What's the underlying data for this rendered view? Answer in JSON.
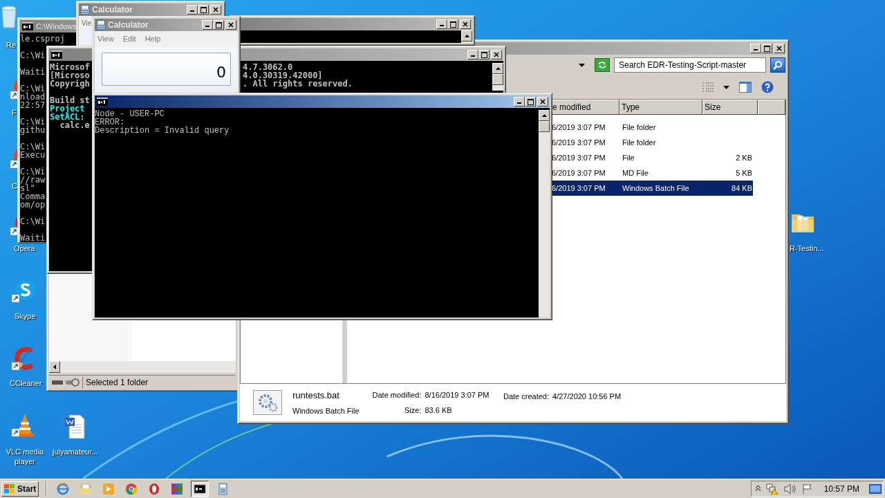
{
  "desktop_icons": [
    {
      "kind": "recycle",
      "label": "Re"
    },
    {
      "kind": "firefox",
      "label": "F"
    },
    {
      "kind": "chrome",
      "label": "C"
    },
    {
      "kind": "opera",
      "label": "Opera"
    },
    {
      "kind": "skype",
      "label": "Skype"
    },
    {
      "kind": "ccleaner",
      "label": "CCleaner"
    },
    {
      "kind": "vlc",
      "label": "VLC media player"
    },
    {
      "kind": "word",
      "label": "julyamateur..."
    },
    {
      "kind": "folder",
      "label": "R-Testin..."
    }
  ],
  "explorer_back": {
    "status": "Selected 1 folder"
  },
  "explorer": {
    "active": false,
    "search_placeholder": "Search EDR-Testing-Script-master",
    "columns": [
      "e modified",
      "Type",
      "Size"
    ],
    "rows": [
      {
        "modified": "6/2019 3:07 PM",
        "type": "File folder",
        "selected": false
      },
      {
        "modified": "6/2019 3:07 PM",
        "type": "File folder",
        "selected": false
      },
      {
        "modified": "6/2019 3:07 PM",
        "type": "File",
        "size": "2 KB",
        "selected": false
      },
      {
        "modified": "6/2019 3:07 PM",
        "type": "MD File",
        "size": "5 KB",
        "selected": false
      },
      {
        "modified": "6/2019 3:07 PM",
        "type": "Windows Batch File",
        "size": "84 KB",
        "selected": true
      }
    ],
    "details": {
      "name": "runtests.bat",
      "type": "Windows Batch File",
      "modified_label": "Date modified:",
      "modified": "8/16/2019 3:07 PM",
      "size_label": "Size:",
      "size": "83.6 KB",
      "created_label": "Date created:",
      "created": "4/27/2020 10:56 PM"
    }
  },
  "cmd_left": {
    "active": false,
    "title": "C:\\Windows",
    "blocks": [
      [
        "le.csproj"
      ],
      [
        "C:\\Wi"
      ],
      [
        "Waiti"
      ],
      [
        "C:\\Wi",
        "nload",
        "22:57"
      ],
      [
        "C:\\Wi",
        "githu"
      ],
      [
        "C:\\Wi",
        "Execu"
      ],
      [
        "C:\\Wi",
        "//raw",
        "sl\"",
        "Comma",
        "om/op"
      ],
      [
        "C:\\Wi"
      ],
      [
        "Waiti"
      ]
    ]
  },
  "calculator_back": {
    "active": false,
    "title": "Calculator",
    "menu": [
      "Vie"
    ]
  },
  "cmd_top": {
    "active": false
  },
  "cmd_middle": {
    "active": false,
    "left_blocks": [
      [
        {
          "text": "Microsof",
          "color": "#c0c0c0"
        },
        {
          "text": "[Microso",
          "color": "#c0c0c0"
        },
        {
          "text": "Copyrigh",
          "color": "#c0c0c0"
        }
      ],
      [
        {
          "text": "Build st",
          "color": "#c0c0c0"
        },
        {
          "text": "Project",
          "color": "#00ffff"
        },
        {
          "text": "SetACL:",
          "color": "#00ffff"
        },
        {
          "text": "  calc.e",
          "color": "#c0c0c0"
        }
      ]
    ],
    "right_lines": [
      "4.7.3062.0",
      "4.0.30319.42000]",
      ". All rights reserved."
    ]
  },
  "calculator_front": {
    "active": false,
    "title": "Calculator",
    "menu": [
      "View",
      "Edit",
      "Help"
    ],
    "display": "0"
  },
  "cmd_front": {
    "active": true,
    "lines": [
      "Node - USER-PC",
      "ERROR:",
      "Description = Invalid query"
    ]
  },
  "taskbar": {
    "start": "Start",
    "items": [
      {
        "kind": "ie",
        "selected": false
      },
      {
        "kind": "explorer",
        "selected": false
      },
      {
        "kind": "media",
        "selected": false
      },
      {
        "kind": "chrome",
        "selected": false
      },
      {
        "kind": "opera",
        "selected": false
      },
      {
        "kind": "archive",
        "selected": false
      },
      {
        "kind": "cmd",
        "selected": true
      },
      {
        "kind": "calc",
        "selected": false
      }
    ],
    "clock": "10:57 PM"
  }
}
